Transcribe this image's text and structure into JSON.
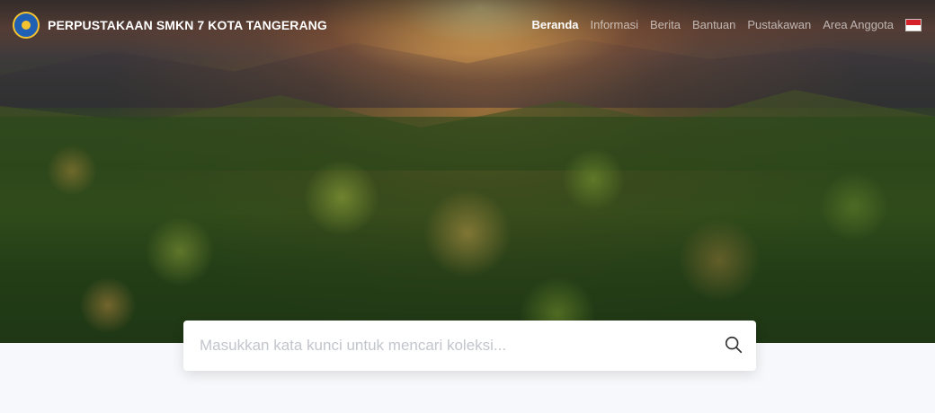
{
  "brand": {
    "name": "PERPUSTAKAAN SMKN 7 KOTA TANGERANG",
    "logo_icon": "school-emblem-icon"
  },
  "nav": {
    "items": [
      {
        "label": "Beranda",
        "active": true
      },
      {
        "label": "Informasi",
        "active": false
      },
      {
        "label": "Berita",
        "active": false
      },
      {
        "label": "Bantuan",
        "active": false
      },
      {
        "label": "Pustakawan",
        "active": false
      },
      {
        "label": "Area Anggota",
        "active": false
      }
    ],
    "language_icon": "indonesia-flag-icon"
  },
  "search": {
    "placeholder": "Masukkan kata kunci untuk mencari koleksi...",
    "value": "",
    "button_icon": "search-icon"
  },
  "hero": {
    "image": "forest-sunrise-landscape"
  },
  "colors": {
    "background": "#f7f8fb",
    "flag_red": "#d6202a",
    "flag_white": "#ffffff"
  }
}
